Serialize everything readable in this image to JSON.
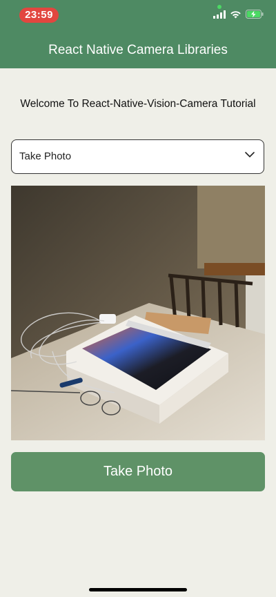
{
  "status_bar": {
    "time": "23:59"
  },
  "header": {
    "title": "React Native Camera Libraries"
  },
  "main": {
    "welcome_text": "Welcome To React-Native-Vision-Camera Tutorial",
    "dropdown": {
      "selected_value": "Take Photo",
      "icon": "chevron-down-icon"
    },
    "photo": {
      "alt": "Captured photo preview"
    },
    "action_button": {
      "label": "Take Photo"
    }
  },
  "colors": {
    "header": "#4e8a63",
    "button": "#5f9267",
    "background": "#efefe8",
    "time_pill": "#e2463f"
  }
}
